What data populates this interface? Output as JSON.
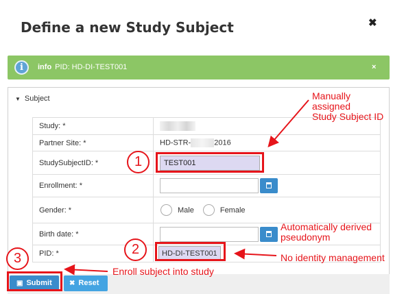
{
  "dialog": {
    "title": "Define a new Study Subject",
    "close_glyph": "✖"
  },
  "alert": {
    "icon_glyph": "i",
    "label": "info",
    "message": "PID: HD-DI-TEST001",
    "close_glyph": "×",
    "color": "#8cc665"
  },
  "section": {
    "toggle_glyph": "▼",
    "title": "Subject"
  },
  "form": {
    "study_label": "Study: *",
    "partner_site_label": "Partner Site: *",
    "partner_site_prefix": "HD-STR-",
    "partner_site_suffix": "2016",
    "ssid_label": "StudySubjectID: *",
    "ssid_value": "TEST001",
    "enrollment_label": "Enrollment: *",
    "gender_label": "Gender: *",
    "gender_options": [
      "Male",
      "Female"
    ],
    "birth_date_label": "Birth date: *",
    "pid_label": "PID: *",
    "pid_value": "HD-DI-TEST001"
  },
  "buttons": {
    "submit_label": "Submit",
    "reset_label": "Reset",
    "reset_glyph": "✖",
    "accent": "#3a8ccb"
  },
  "annotations": {
    "num1": "1",
    "num2": "2",
    "num3": "3",
    "manual_line1": "Manually",
    "manual_line2": "assigned",
    "manual_line3": "Study Subject ID",
    "derived_line1": "Automatically derived",
    "derived_line2": "pseudonym",
    "no_identity": "No identity management",
    "enroll": "Enroll subject into study",
    "color": "#e6141a"
  }
}
